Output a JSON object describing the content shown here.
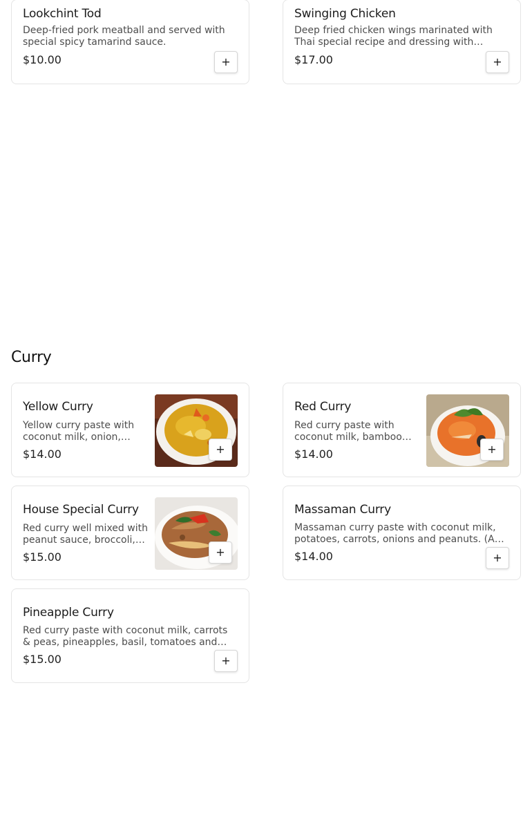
{
  "appetizers": {
    "items": [
      {
        "name": "Lookchint Tod",
        "description": "Deep-fried pork meatball and served with special spicy tamarind sauce.",
        "price": "$10.00"
      },
      {
        "name": "Swinging Chicken",
        "description": "Deep fried chicken wings marinated with Thai special recipe and dressing with sweet chili sauce.",
        "price": "$17.00"
      }
    ]
  },
  "curry": {
    "title": "Curry",
    "items": [
      {
        "name": "Yellow Curry",
        "description": "Yellow curry paste with coconut milk, onion, potatoes and carrots.",
        "price": "$14.00",
        "image": "yellow-curry-bowl"
      },
      {
        "name": "Red Curry",
        "description": "Red curry paste with coconut milk, bamboo shoots, bell peppers and basil.",
        "price": "$14.00",
        "image": "red-curry-bowl"
      },
      {
        "name": "House Special Curry",
        "description": "Red curry well mixed with peanut sauce, broccoli, carrots and bell peppers.",
        "price": "$15.00",
        "image": "house-special-curry-plate"
      },
      {
        "name": "Massaman Curry",
        "description": "Massaman curry paste with coconut milk, potatoes, carrots, onions and peanuts. (All curries served with rice.)",
        "price": "$14.00"
      },
      {
        "name": "Pineapple Curry",
        "description": "Red curry paste with coconut milk, carrots & peas, pineapples, basil, tomatoes and bell peppers.",
        "price": "$15.00"
      }
    ]
  },
  "add_button_icon": "plus-icon",
  "add_button_glyph": "+",
  "colors": {
    "card_border": "#e4e4e4",
    "text_primary": "#1c1c1c",
    "text_secondary": "#4d4d4d"
  }
}
